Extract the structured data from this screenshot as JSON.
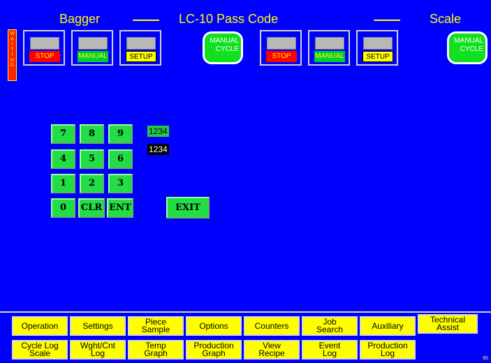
{
  "header": {
    "left": "Bagger",
    "center": "LC-10 Pass Code",
    "right": "Scale"
  },
  "status": {
    "waiting": "WAITING"
  },
  "left_group": {
    "stop": "STOP",
    "manual": "MANUAL",
    "setup": "SETUP",
    "cycle_line1": "MANUAL",
    "cycle_line2": "CYCLE"
  },
  "right_group": {
    "stop": "STOP",
    "manual": "MANUAL",
    "setup": "SETUP",
    "cycle_line1": "MANUAL",
    "cycle_line2": "CYCLE"
  },
  "keypad": {
    "keys": [
      "7",
      "8",
      "9",
      "4",
      "5",
      "6",
      "1",
      "2",
      "3",
      "0",
      "CLR",
      "ENT"
    ],
    "exit": "EXIT",
    "entry_display": "1234",
    "code_display": "1234"
  },
  "nav_row1": [
    {
      "l1": "Operation",
      "l2": ""
    },
    {
      "l1": "Settings",
      "l2": ""
    },
    {
      "l1": "Piece",
      "l2": "Sample"
    },
    {
      "l1": "Options",
      "l2": ""
    },
    {
      "l1": "Counters",
      "l2": ""
    },
    {
      "l1": "Job",
      "l2": "Search"
    },
    {
      "l1": "Auxiliary",
      "l2": ""
    },
    {
      "l1": "Technical",
      "l2": "Assist"
    }
  ],
  "nav_row2": [
    {
      "l1": "Cycle Log",
      "l2": "Scale"
    },
    {
      "l1": "Wght/Cnt",
      "l2": "Log"
    },
    {
      "l1": "Temp",
      "l2": "Graph"
    },
    {
      "l1": "Production",
      "l2": "Graph"
    },
    {
      "l1": "View",
      "l2": "Recipe"
    },
    {
      "l1": "Event",
      "l2": "Log"
    },
    {
      "l1": "Production",
      "l2": "Log"
    }
  ],
  "corner_number": "80",
  "colors": {
    "background": "#0000ff",
    "accent": "#ffff00",
    "key_green": "#22dd44"
  }
}
